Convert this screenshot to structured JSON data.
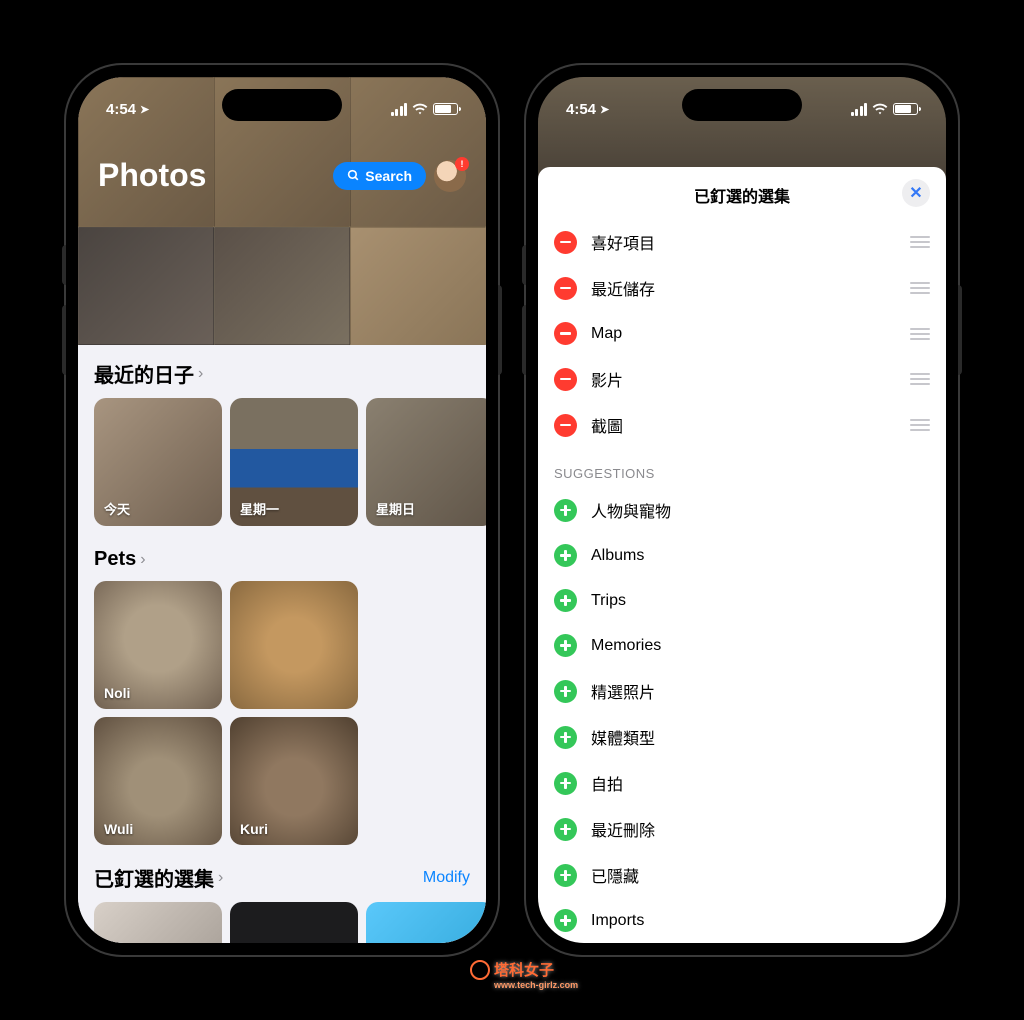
{
  "status": {
    "time": "4:54"
  },
  "left": {
    "app_title": "Photos",
    "search_label": "Search",
    "sections": {
      "recent_days": {
        "title": "最近的日子",
        "items": [
          "今天",
          "星期一",
          "星期日"
        ]
      },
      "pets": {
        "title": "Pets",
        "items": [
          "Noli",
          "",
          "Wuli",
          "Kuri"
        ]
      },
      "pinned": {
        "title": "已釘選的選集",
        "modify": "Modify"
      }
    }
  },
  "right": {
    "sheet_title": "已釘選的選集",
    "pinned_items": [
      "喜好項目",
      "最近儲存",
      "Map",
      "影片",
      "截圖"
    ],
    "suggestions_header": "SUGGESTIONS",
    "suggestions": [
      "人物與寵物",
      "Albums",
      "Trips",
      "Memories",
      "精選照片",
      "媒體類型",
      "自拍",
      "最近刪除",
      "已隱藏",
      "Imports"
    ]
  },
  "watermark": {
    "text": "塔科女子",
    "sub": "www.tech-girlz.com"
  }
}
